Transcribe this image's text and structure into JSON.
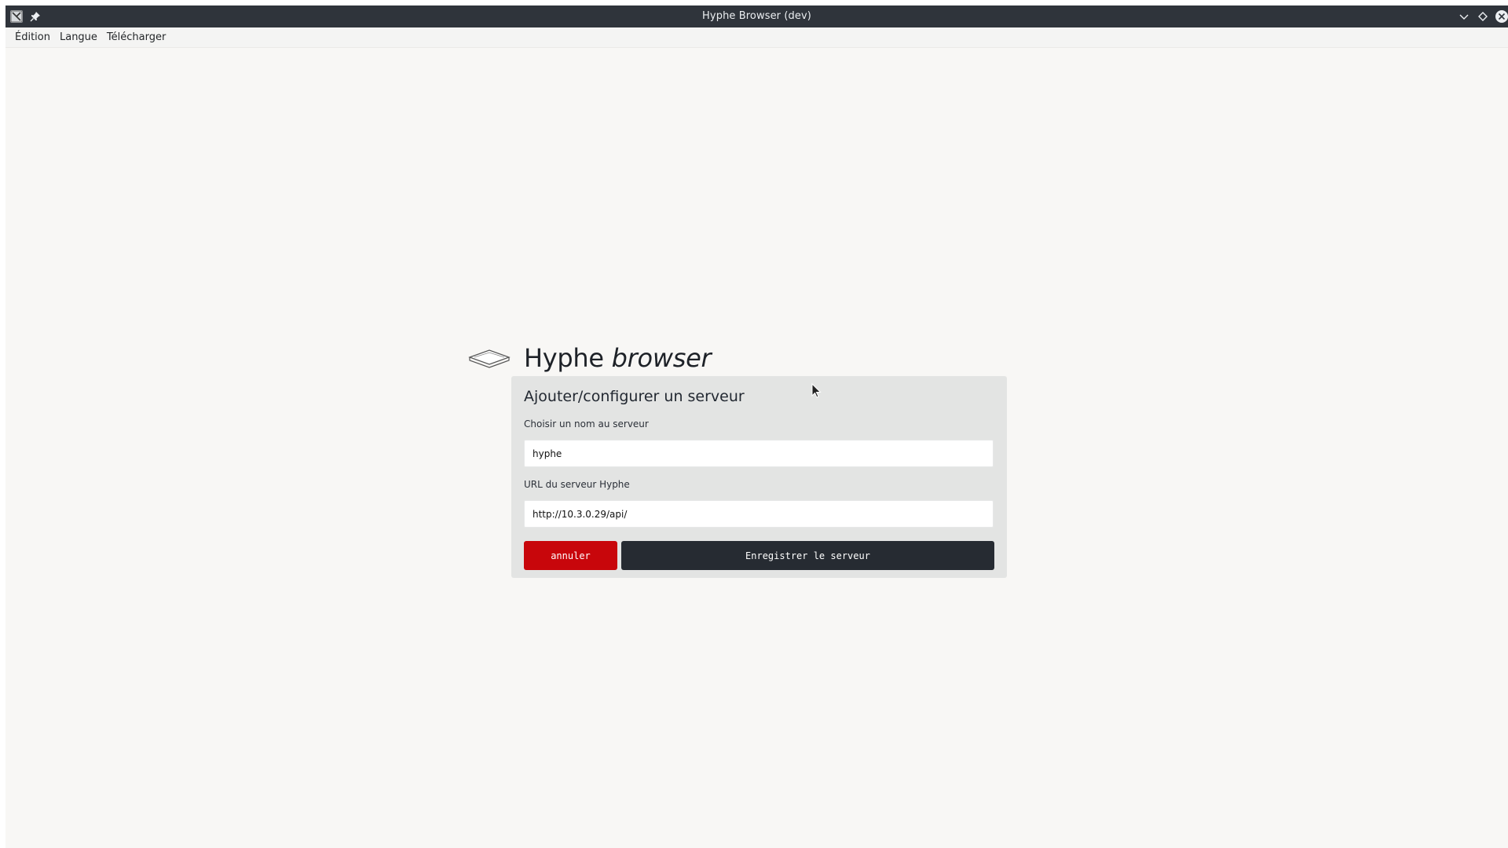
{
  "window": {
    "title": "Hyphe Browser (dev)",
    "buttons": [
      "chevron-down-icon",
      "diamond-icon",
      "close-icon"
    ]
  },
  "menubar": {
    "items": [
      "Édition",
      "Langue",
      "Télécharger"
    ]
  },
  "brand": {
    "name": "Hyphe",
    "name_italic": "browser"
  },
  "form": {
    "heading": "Ajouter/configurer un serveur",
    "name_label": "Choisir un nom au serveur",
    "name_value": "hyphe",
    "url_label": "URL du serveur Hyphe",
    "url_value": "http://10.3.0.29/api/",
    "cancel_label": "annuler",
    "save_label": "Enregistrer le serveur"
  },
  "colors": {
    "titlebar": "#2f343b",
    "background": "#f8f7f5",
    "panel": "#e3e4e3",
    "cancel": "#c8060b",
    "save": "#262b32"
  }
}
